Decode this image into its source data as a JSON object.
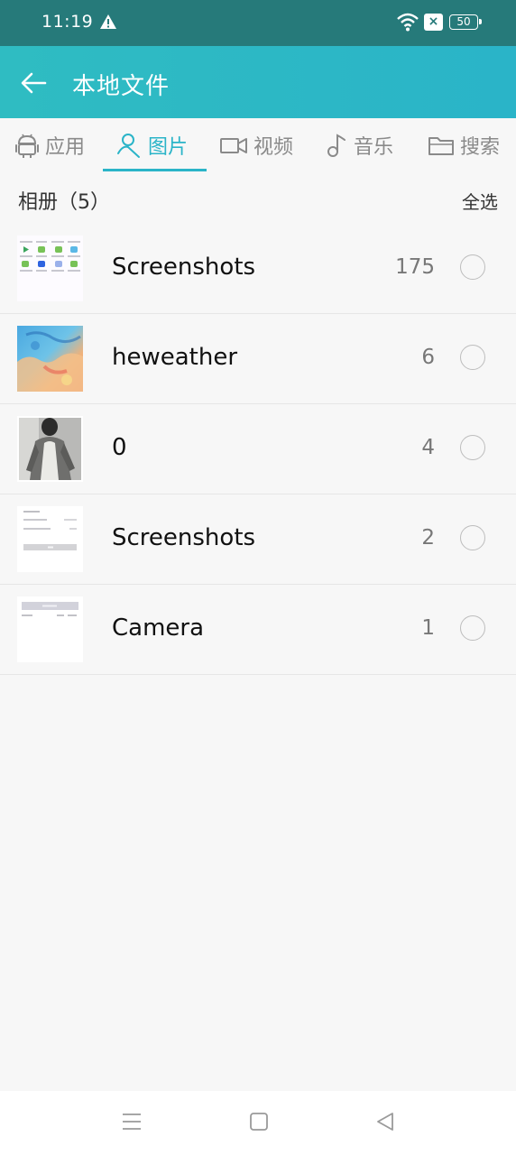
{
  "status_bar": {
    "time": "11:19",
    "battery": "50",
    "sim_badge": "×",
    "icons": [
      "warning-icon",
      "wifi-icon",
      "sim-x-icon",
      "battery-icon"
    ]
  },
  "header": {
    "title": "本地文件",
    "back_icon": "back-arrow-icon",
    "background_color": "#2fbcc2"
  },
  "tabs": [
    {
      "label": "应用",
      "icon": "android-icon",
      "active": false
    },
    {
      "label": "图片",
      "icon": "person-image-icon",
      "active": true
    },
    {
      "label": "视频",
      "icon": "video-camera-icon",
      "active": false
    },
    {
      "label": "音乐",
      "icon": "music-note-icon",
      "active": false
    },
    {
      "label": "搜索",
      "icon": "folder-icon",
      "active": false
    }
  ],
  "album_section": {
    "title": "相册（5）",
    "select_all": "全选"
  },
  "albums": [
    {
      "name": "Screenshots",
      "count": "175",
      "thumb": "app-grid-thumbnail"
    },
    {
      "name": "heweather",
      "count": "6",
      "thumb": "weather-map-thumbnail"
    },
    {
      "name": "0",
      "count": "4",
      "thumb": "person-photo-thumbnail"
    },
    {
      "name": "Screenshots",
      "count": "2",
      "thumb": "form-screenshot-thumbnail"
    },
    {
      "name": "Camera",
      "count": "1",
      "thumb": "dialog-screenshot-thumbnail"
    }
  ],
  "nav_bar": {
    "icons": [
      "menu-icon",
      "home-icon",
      "back-triangle-icon"
    ]
  },
  "colors": {
    "accent": "#2ab4c8",
    "status_bar": "#267a7a",
    "background": "#f7f7f7"
  }
}
